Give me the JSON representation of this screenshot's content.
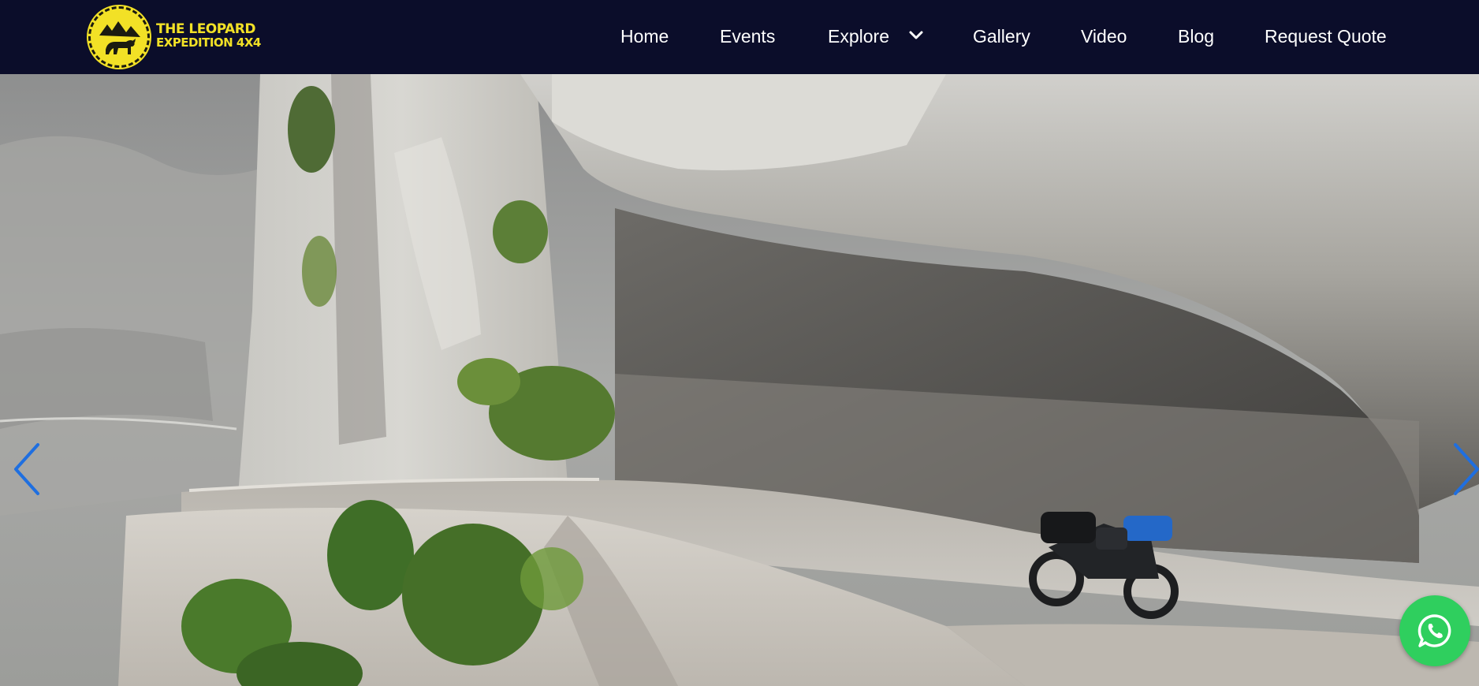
{
  "brand": {
    "line1": "THE LEOPARD",
    "line2": "EXPEDITION 4X4",
    "logo_icon": "leopard-badge-icon",
    "accent_color": "#f2e126"
  },
  "nav": {
    "items": [
      {
        "label": "Home"
      },
      {
        "label": "Events"
      },
      {
        "label": "Explore",
        "icon": "chevron-down-icon"
      },
      {
        "label": "Gallery"
      },
      {
        "label": "Video"
      },
      {
        "label": "Blog"
      },
      {
        "label": "Request Quote"
      }
    ],
    "background_color": "#0b0d2a"
  },
  "hero": {
    "prev_icon": "chevron-left-icon",
    "next_icon": "chevron-right-icon",
    "arrow_color": "#1f6fe0"
  },
  "whatsapp": {
    "icon": "whatsapp-icon",
    "color": "#2fcf5e"
  }
}
